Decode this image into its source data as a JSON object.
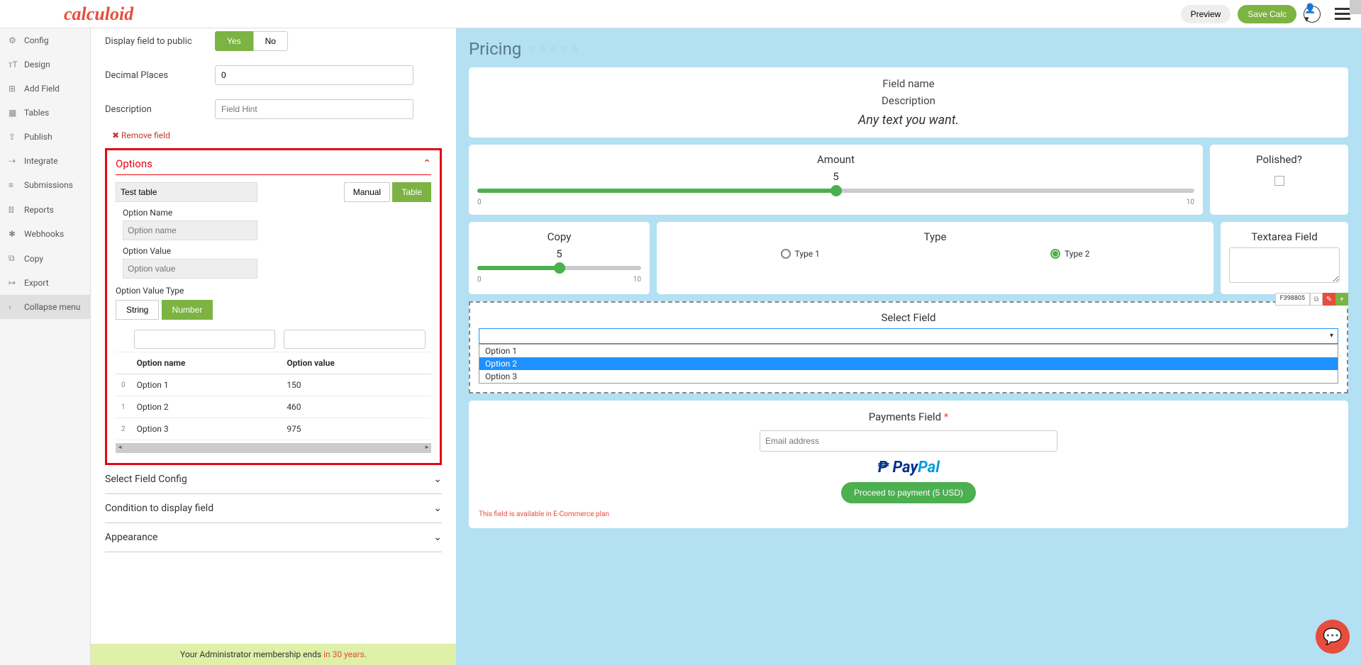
{
  "header": {
    "logo": "calculoid",
    "preview": "Preview",
    "save": "Save Calc"
  },
  "sidebar": {
    "items": [
      {
        "icon": "⚙",
        "label": "Config"
      },
      {
        "icon": "ᴛT",
        "label": "Design"
      },
      {
        "icon": "⊞",
        "label": "Add Field"
      },
      {
        "icon": "▦",
        "label": "Tables"
      },
      {
        "icon": "⇪",
        "label": "Publish"
      },
      {
        "icon": "⇢",
        "label": "Integrate"
      },
      {
        "icon": "≡",
        "label": "Submissions"
      },
      {
        "icon": "⫾⫾",
        "label": "Reports"
      },
      {
        "icon": "✱",
        "label": "Webhooks"
      },
      {
        "icon": "⧉",
        "label": "Copy"
      },
      {
        "icon": "↦",
        "label": "Export"
      },
      {
        "icon": "‹",
        "label": "Collapse menu"
      }
    ]
  },
  "form": {
    "display_label": "Display field to public",
    "yes": "Yes",
    "no": "No",
    "decimal_label": "Decimal Places",
    "decimal_value": "0",
    "desc_label": "Description",
    "desc_placeholder": "Field Hint",
    "remove": "✖ Remove field"
  },
  "options": {
    "title": "Options",
    "table_name": "Test table",
    "manual": "Manual",
    "table": "Table",
    "option_name_label": "Option Name",
    "option_name_placeholder": "Option name",
    "option_value_label": "Option Value",
    "option_value_placeholder": "Option value",
    "value_type_label": "Option Value Type",
    "string": "String",
    "number": "Number",
    "col_name": "Option name",
    "col_value": "Option value",
    "rows": [
      {
        "idx": "0",
        "name": "Option 1",
        "value": "150"
      },
      {
        "idx": "1",
        "name": "Option 2",
        "value": "460"
      },
      {
        "idx": "2",
        "name": "Option 3",
        "value": "975"
      }
    ]
  },
  "sections": {
    "select_config": "Select Field Config",
    "condition": "Condition to display field",
    "appearance": "Appearance"
  },
  "footer": {
    "text": "Your Administrator membership ends ",
    "years": "in 30 years."
  },
  "preview": {
    "title": "Pricing",
    "field_name": "Field name",
    "description": "Description",
    "any_text": "Any text you want.",
    "amount": {
      "title": "Amount",
      "value": "5",
      "min": "0",
      "max": "10",
      "pct": 50
    },
    "polished": {
      "title": "Polished?"
    },
    "copy": {
      "title": "Copy",
      "value": "5",
      "min": "0",
      "max": "10",
      "pct": 50
    },
    "type": {
      "title": "Type",
      "opt1": "Type 1",
      "opt2": "Type 2"
    },
    "textarea": {
      "title": "Textarea Field"
    },
    "select": {
      "title": "Select Field",
      "field_id": "F398805",
      "items": [
        "Option 1",
        "Option 2",
        "Option 3"
      ]
    },
    "payments": {
      "title": "Payments Field",
      "email_placeholder": "Email address",
      "paypal1": "Pay",
      "paypal2": "Pal",
      "proceed": "Proceed to payment (5 USD)",
      "note": "This field is available in E-Commerce plan"
    }
  }
}
